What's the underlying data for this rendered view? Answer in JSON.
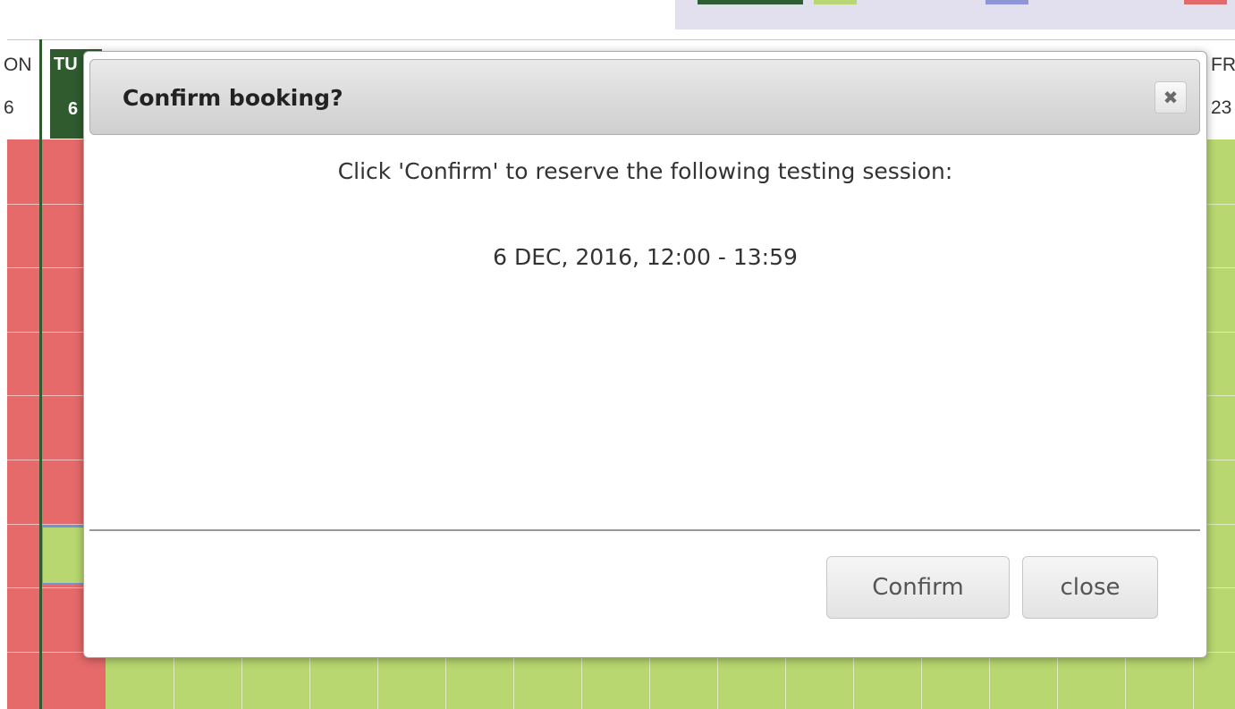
{
  "calendar": {
    "header_left_day": "ON",
    "header_left_date": "6",
    "today_day": "TU",
    "today_date": "6",
    "header_right_day": "FR",
    "header_right_date": "23"
  },
  "modal": {
    "title": "Confirm booking?",
    "close_icon": "✖",
    "message": "Click 'Confirm' to reserve the following testing session:",
    "session": "6 DEC, 2016, 12:00 - 13:59",
    "confirm_label": "Confirm",
    "close_label": "close"
  },
  "colors": {
    "booked": "#e66a6a",
    "available": "#b8d770",
    "today": "#2f5b2f",
    "selected_border": "#6e95d6"
  }
}
